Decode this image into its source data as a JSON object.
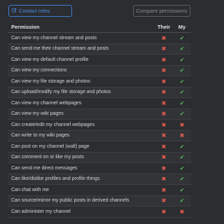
{
  "toolbar": {
    "contact_roles_label": "Contact roles",
    "compare_permissions_label": "Compare permissions"
  },
  "table": {
    "headers": {
      "permission": "Permission",
      "their": "Their",
      "my": "My"
    },
    "rows": [
      {
        "label": "Can view my channel stream and posts",
        "their": "no",
        "my": "yes"
      },
      {
        "label": "Can send me their channel stream and posts",
        "their": "no",
        "my": "yes"
      },
      {
        "label": "Can view my default channel profile",
        "their": "no",
        "my": "yes"
      },
      {
        "label": "Can view my connections",
        "their": "no",
        "my": "yes"
      },
      {
        "label": "Can view my file storage and photos",
        "their": "no",
        "my": "yes"
      },
      {
        "label": "Can upload/modify my file storage and photos",
        "their": "no",
        "my": "yes"
      },
      {
        "label": "Can view my channel webpages",
        "their": "no",
        "my": "yes"
      },
      {
        "label": "Can view my wiki pages",
        "their": "no",
        "my": "yes"
      },
      {
        "label": "Can create/edit my channel webpages",
        "their": "no",
        "my": "no"
      },
      {
        "label": "Can write to my wiki pages",
        "their": "no",
        "my": "no"
      },
      {
        "label": "Can post on my channel (wall) page",
        "their": "no",
        "my": "yes"
      },
      {
        "label": "Can comment on or like my posts",
        "their": "no",
        "my": "yes"
      },
      {
        "label": "Can send me direct messages",
        "their": "no",
        "my": "yes"
      },
      {
        "label": "Can like/dislike profiles and profile things",
        "their": "no",
        "my": "yes"
      },
      {
        "label": "Can chat with me",
        "their": "no",
        "my": "yes"
      },
      {
        "label": "Can source/mirror my public posts in derived channels",
        "their": "no",
        "my": "yes"
      },
      {
        "label": "Can administer my channel",
        "their": "no",
        "my": "no"
      }
    ]
  },
  "icons": {
    "edit": "pencil-square-icon",
    "yes": "check-icon",
    "no": "cross-icon"
  },
  "colors": {
    "accent": "#3d7bd4",
    "yes": "#4caf50",
    "no": "#e05a4e"
  }
}
